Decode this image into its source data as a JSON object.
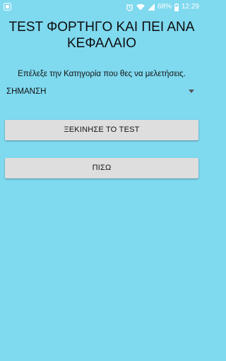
{
  "status_bar": {
    "battery_percent": "68%",
    "time": "12:29",
    "icons": [
      "notification-icon",
      "alarm-icon",
      "wifi-icon",
      "signal-icon",
      "battery-icon"
    ]
  },
  "title": "TEST ΦΟΡΤΗΓΟ ΚΑΙ ΠΕΙ ΑΝΑ ΚΕΦΑΛΑΙΟ",
  "prompt": "Επέλεξε την Κατηγορία που θες να μελετήσεις.",
  "category_select": {
    "selected": "ΣΗΜΑΝΣΗ"
  },
  "buttons": {
    "start_label": "ΞΕΚΙΝΗΣΕ ΤΟ TEST",
    "back_label": "ΠΙΣΩ"
  },
  "colors": {
    "background": "#7fd9ef",
    "button": "#dedede",
    "text": "#111111"
  }
}
